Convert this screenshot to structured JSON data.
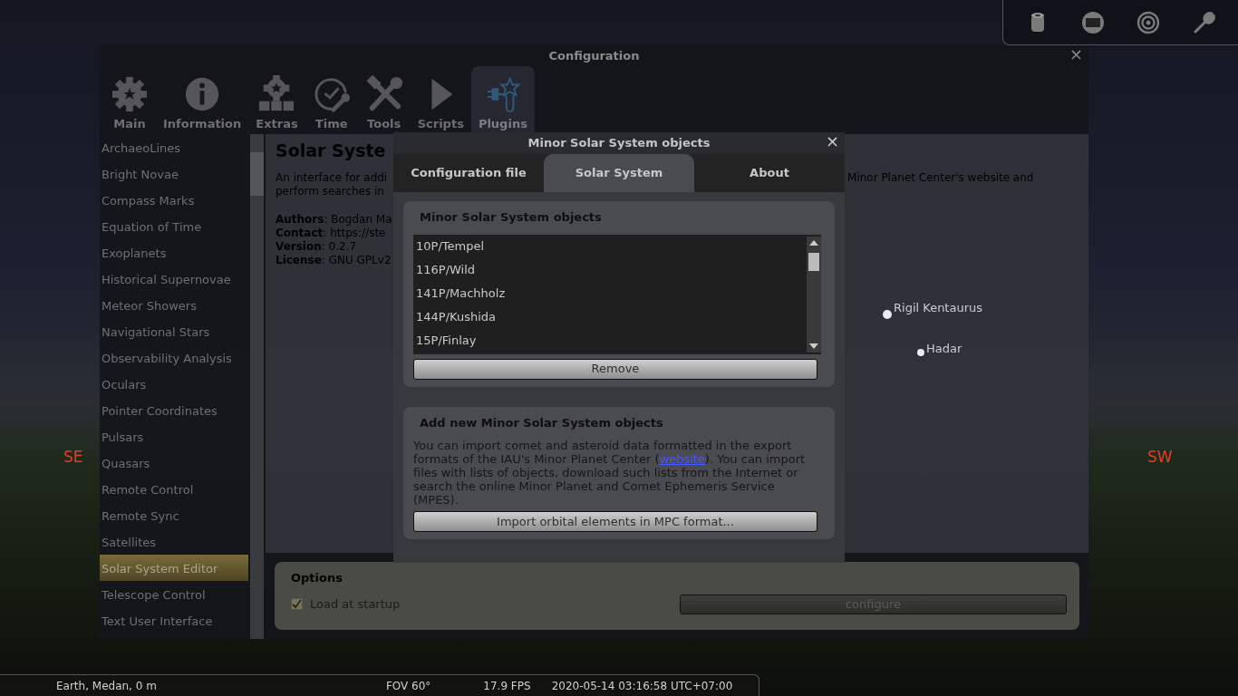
{
  "sky_labels": [
    {
      "kind": "star",
      "text": "Rigil Kentaurus"
    },
    {
      "kind": "star",
      "text": "Hadar"
    },
    {
      "kind": "compass",
      "text": "SE"
    },
    {
      "kind": "compass",
      "text": "SW"
    }
  ],
  "config_window": {
    "title": "Configuration",
    "close": "×",
    "tabs": [
      {
        "label": "Main",
        "selected": false
      },
      {
        "label": "Information",
        "selected": false
      },
      {
        "label": "Extras",
        "selected": false
      },
      {
        "label": "Time",
        "selected": false
      },
      {
        "label": "Tools",
        "selected": false
      },
      {
        "label": "Scripts",
        "selected": false
      },
      {
        "label": "Plugins",
        "selected": true
      }
    ],
    "plugins": [
      {
        "label": "ArchaeoLines",
        "selected": false
      },
      {
        "label": "Bright Novae",
        "selected": false
      },
      {
        "label": "Compass Marks",
        "selected": false
      },
      {
        "label": "Equation of Time",
        "selected": false
      },
      {
        "label": "Exoplanets",
        "selected": false
      },
      {
        "label": "Historical Supernovae",
        "selected": false
      },
      {
        "label": "Meteor Showers",
        "selected": false
      },
      {
        "label": "Navigational Stars",
        "selected": false
      },
      {
        "label": "Observability Analysis",
        "selected": false
      },
      {
        "label": "Oculars",
        "selected": false
      },
      {
        "label": "Pointer Coordinates",
        "selected": false
      },
      {
        "label": "Pulsars",
        "selected": false
      },
      {
        "label": "Quasars",
        "selected": false
      },
      {
        "label": "Remote Control",
        "selected": false
      },
      {
        "label": "Remote Sync",
        "selected": false
      },
      {
        "label": "Satellites",
        "selected": false
      },
      {
        "label": "Solar System Editor",
        "selected": true
      },
      {
        "label": "Telescope Control",
        "selected": false
      },
      {
        "label": "Text User Interface",
        "selected": false
      }
    ],
    "plugin_title": "Solar Syste",
    "plugin_text_left": [
      "An interface for addi",
      "perform searches in"
    ],
    "plugin_text_right": "Minor Planet Center's website and",
    "plugin_info": [
      "**Authors**: Bogdan Ma",
      "**Contact**: https://ste",
      "**Version**: 0.2.7",
      "**License**: GNU GPLv2"
    ],
    "options": {
      "title": "Options",
      "load_at_startup": {
        "label": "Load at startup",
        "checked": true
      },
      "configure_button": "configure"
    }
  },
  "dialog": {
    "title": "Minor Solar System objects",
    "close": "×",
    "tabs": [
      {
        "label": "Configuration file",
        "selected": false
      },
      {
        "label": "Solar System",
        "selected": true
      },
      {
        "label": "About",
        "selected": false
      }
    ],
    "objects_group": {
      "title": "Minor Solar System objects",
      "items": [
        "10P/Tempel",
        "116P/Wild",
        "141P/Machholz",
        "144P/Kushida",
        "15P/Finlay"
      ],
      "remove_button": "Remove"
    },
    "add_group": {
      "title": "Add new Minor Solar System objects",
      "text_before": "You can import comet and asteroid data formatted in the export formats of the IAU's Minor Planet Center (",
      "link": "website",
      "text_after": "). You can import files with lists of objects, download such lists from the Internet or search the online Minor Planet and Comet Ephemeris Service (MPES).",
      "import_button": "Import orbital elements in MPC format..."
    }
  },
  "status_bar": {
    "location": "Earth, Medan, 0 m",
    "fov": "FOV 60°",
    "fps": "17.9 FPS",
    "datetime": "2020-05-14 03:16:58 UTC+07:00"
  }
}
